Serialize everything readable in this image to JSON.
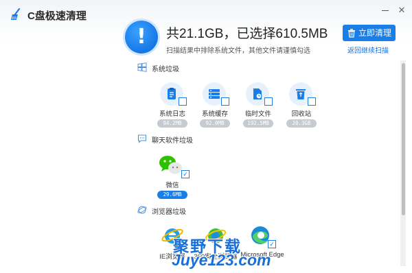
{
  "window": {
    "title": "C盘极速清理",
    "minimize_glyph": "",
    "close_glyph": "✕"
  },
  "summary": {
    "title": "共21.1GB，已选择610.5MB",
    "subtitle": "扫描结果中排除系统文件，其他文件请谨慎勾选",
    "clean_button": "立即清理",
    "back_link": "返回继续扫描",
    "alert_glyph": "!"
  },
  "sections": {
    "system": {
      "title": "系统垃圾",
      "icon": "windows-icon",
      "items": [
        {
          "label": "系统日志",
          "size": "94.2MB",
          "checked": false,
          "icon": "log-icon"
        },
        {
          "label": "系统缓存",
          "size": "92.0MB",
          "checked": false,
          "icon": "cache-icon"
        },
        {
          "label": "临时文件",
          "size": "192.5MB",
          "checked": false,
          "icon": "temp-file-icon"
        },
        {
          "label": "回收站",
          "size": "20.3GB",
          "checked": false,
          "icon": "recycle-bin-icon"
        }
      ]
    },
    "chat": {
      "title": "聊天软件垃圾",
      "icon": "chat-icon",
      "items": [
        {
          "label": "微信",
          "size": "29.6MB",
          "checked": true,
          "icon": "wechat-icon"
        }
      ]
    },
    "browser": {
      "title": "浏览器垃圾",
      "icon": "browser-icon",
      "items": [
        {
          "label": "IE浏览器",
          "icon": "ie-icon"
        },
        {
          "label": "360安全浏览器",
          "icon": "360-browser-icon"
        },
        {
          "label": "Microsoft Edge",
          "icon": "edge-icon"
        }
      ]
    }
  },
  "watermark": {
    "cn": "聚野下载",
    "en": "Juye123.com"
  },
  "colors": {
    "accent": "#1a7ee8",
    "size_pill_inactive": "#c6cbd1",
    "wechat_green": "#2dc100"
  }
}
